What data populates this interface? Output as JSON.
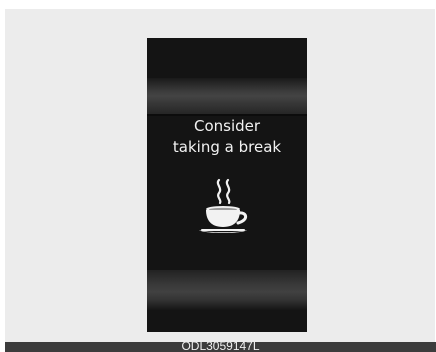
{
  "display": {
    "message_line1": "Consider",
    "message_line2": "taking a break",
    "icon": "coffee-cup-icon"
  },
  "caption": {
    "text": "ODL3059147L"
  },
  "colors": {
    "frame_background": "#ececec",
    "display_background": "#141414",
    "text": "#f2f2f2",
    "caption_bar": "#3c3c3c"
  }
}
